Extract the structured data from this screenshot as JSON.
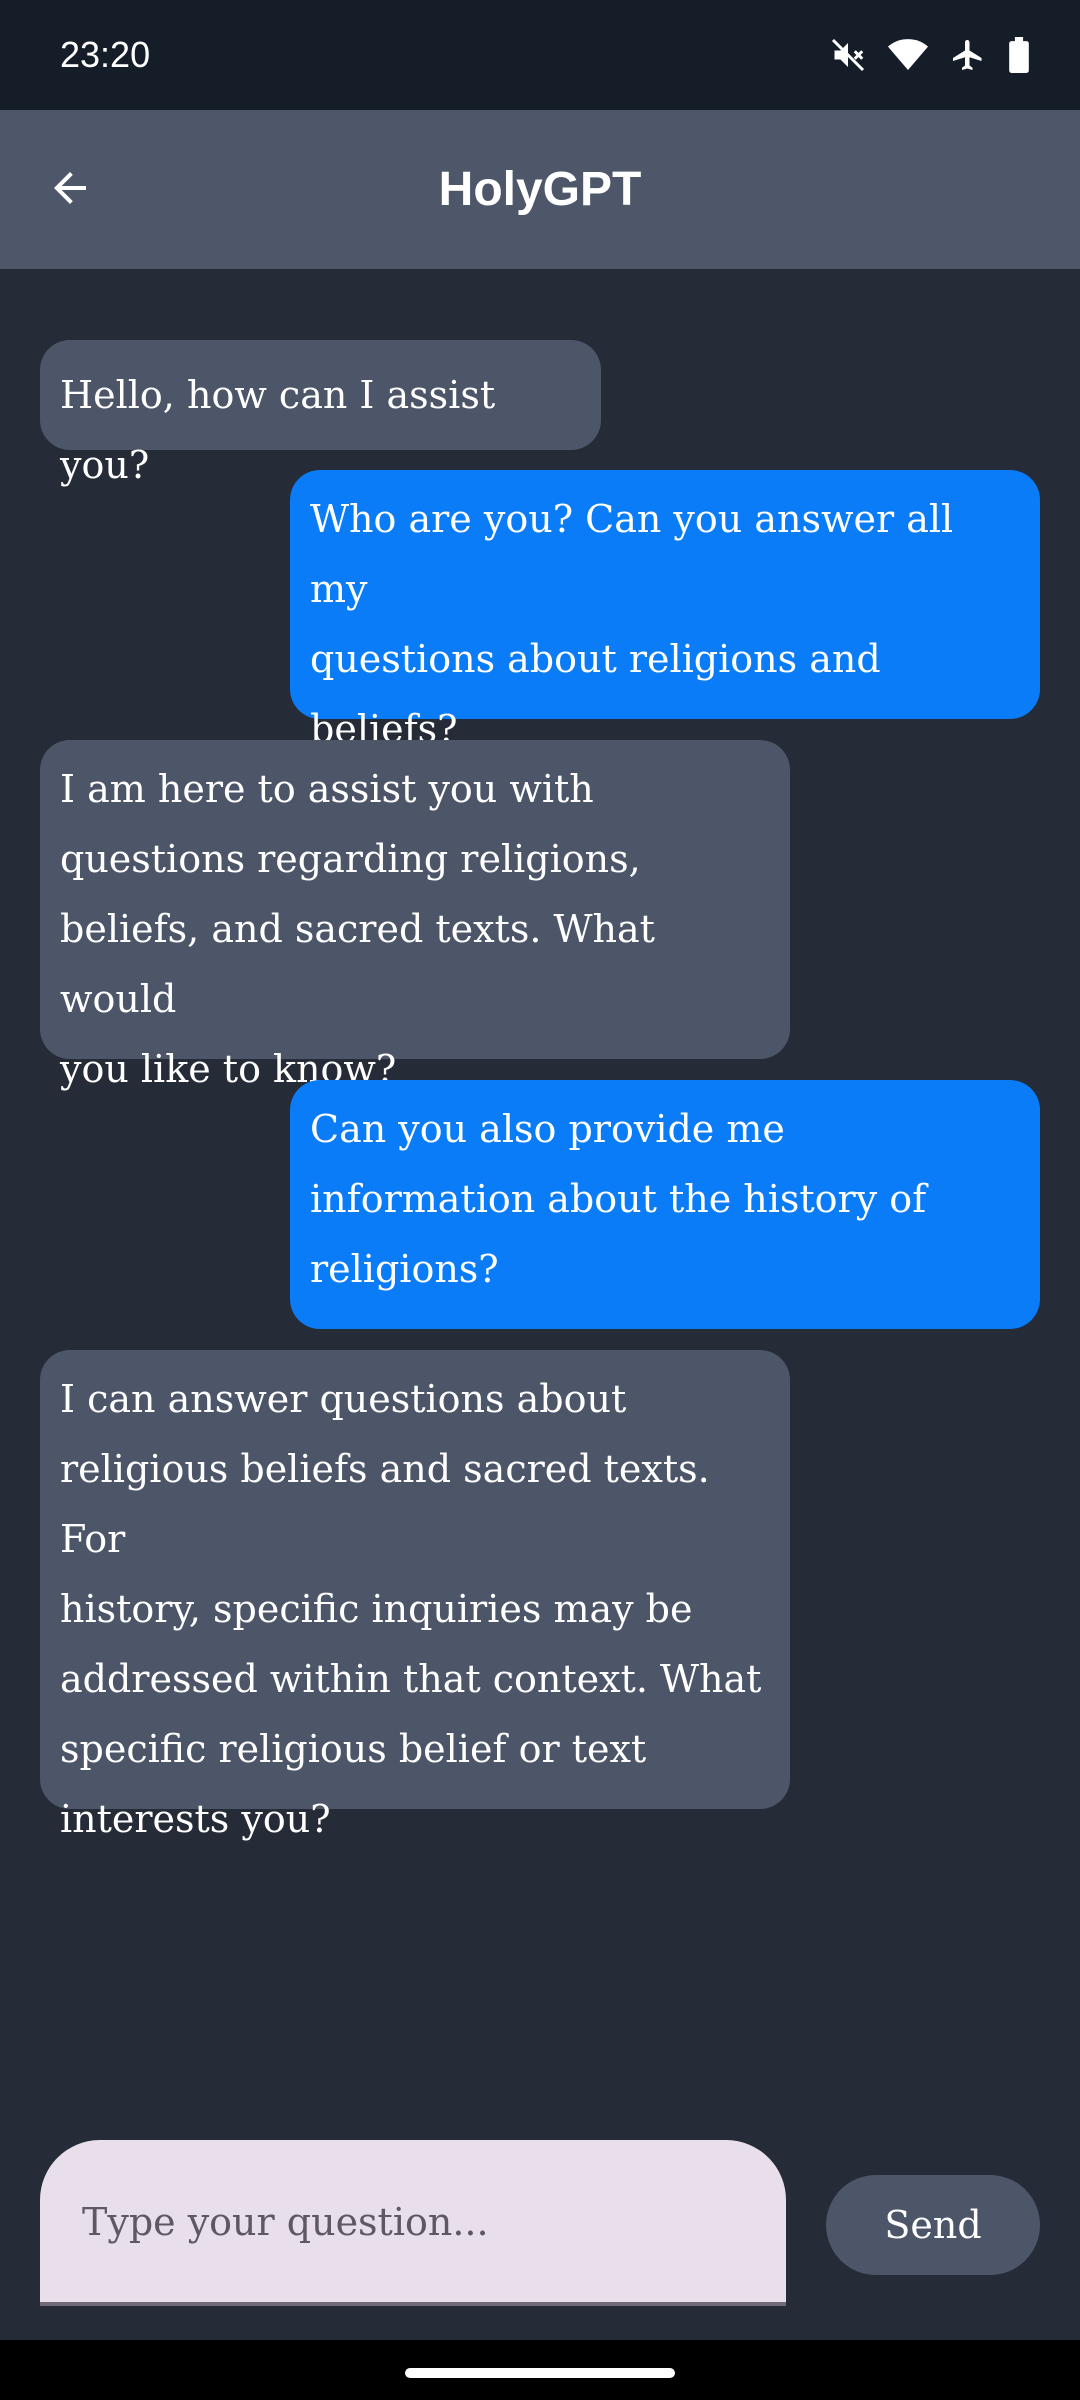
{
  "status_bar": {
    "time": "23:20",
    "icons": [
      "mute-icon",
      "wifi-icon",
      "airplane-icon",
      "battery-icon"
    ]
  },
  "app_bar": {
    "title": "HolyGPT",
    "back_icon": "arrow-left-icon"
  },
  "messages": [
    {
      "role": "bot",
      "text": "Hello, how can I assist you?"
    },
    {
      "role": "user",
      "text": "Who are you? Can you answer all my\nquestions about religions and\nbeliefs?"
    },
    {
      "role": "bot",
      "text": "I am here to assist you with\nquestions regarding religions,\nbeliefs, and sacred texts. What would\nyou like to know?"
    },
    {
      "role": "user",
      "text": "Can you also provide me\ninformation about the history of\nreligions?"
    },
    {
      "role": "bot",
      "text": "I can answer questions about\nreligious beliefs and sacred texts. For\nhistory, specific inquiries may be\naddressed within that context. What\nspecific religious belief or text\ninterests you?"
    }
  ],
  "composer": {
    "value": "",
    "placeholder": "Type your question...",
    "send_label": "Send"
  },
  "colors": {
    "background": "#252c37",
    "status_bar": "#141d28",
    "app_bar": "#4d5769",
    "bot_bubble": "#4d5669",
    "user_bubble": "#0a7cf8",
    "input_background": "#e9dfeb"
  }
}
